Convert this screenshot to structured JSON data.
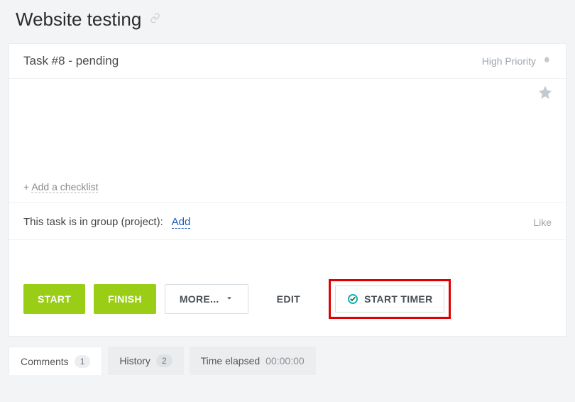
{
  "page": {
    "title": "Website testing"
  },
  "task": {
    "header": "Task #8 - pending",
    "priority_label": "High Priority"
  },
  "checklist": {
    "plus": "+",
    "label": "Add a checklist"
  },
  "group": {
    "text": "This task is in group (project):",
    "add_label": "Add",
    "like_label": "Like"
  },
  "actions": {
    "start": "START",
    "finish": "FINISH",
    "more": "MORE...",
    "edit": "EDIT",
    "start_timer": "START TIMER"
  },
  "tabs": {
    "comments": {
      "label": "Comments",
      "count": "1"
    },
    "history": {
      "label": "History",
      "count": "2"
    },
    "time_elapsed": {
      "label": "Time elapsed",
      "value": "00:00:00"
    }
  }
}
